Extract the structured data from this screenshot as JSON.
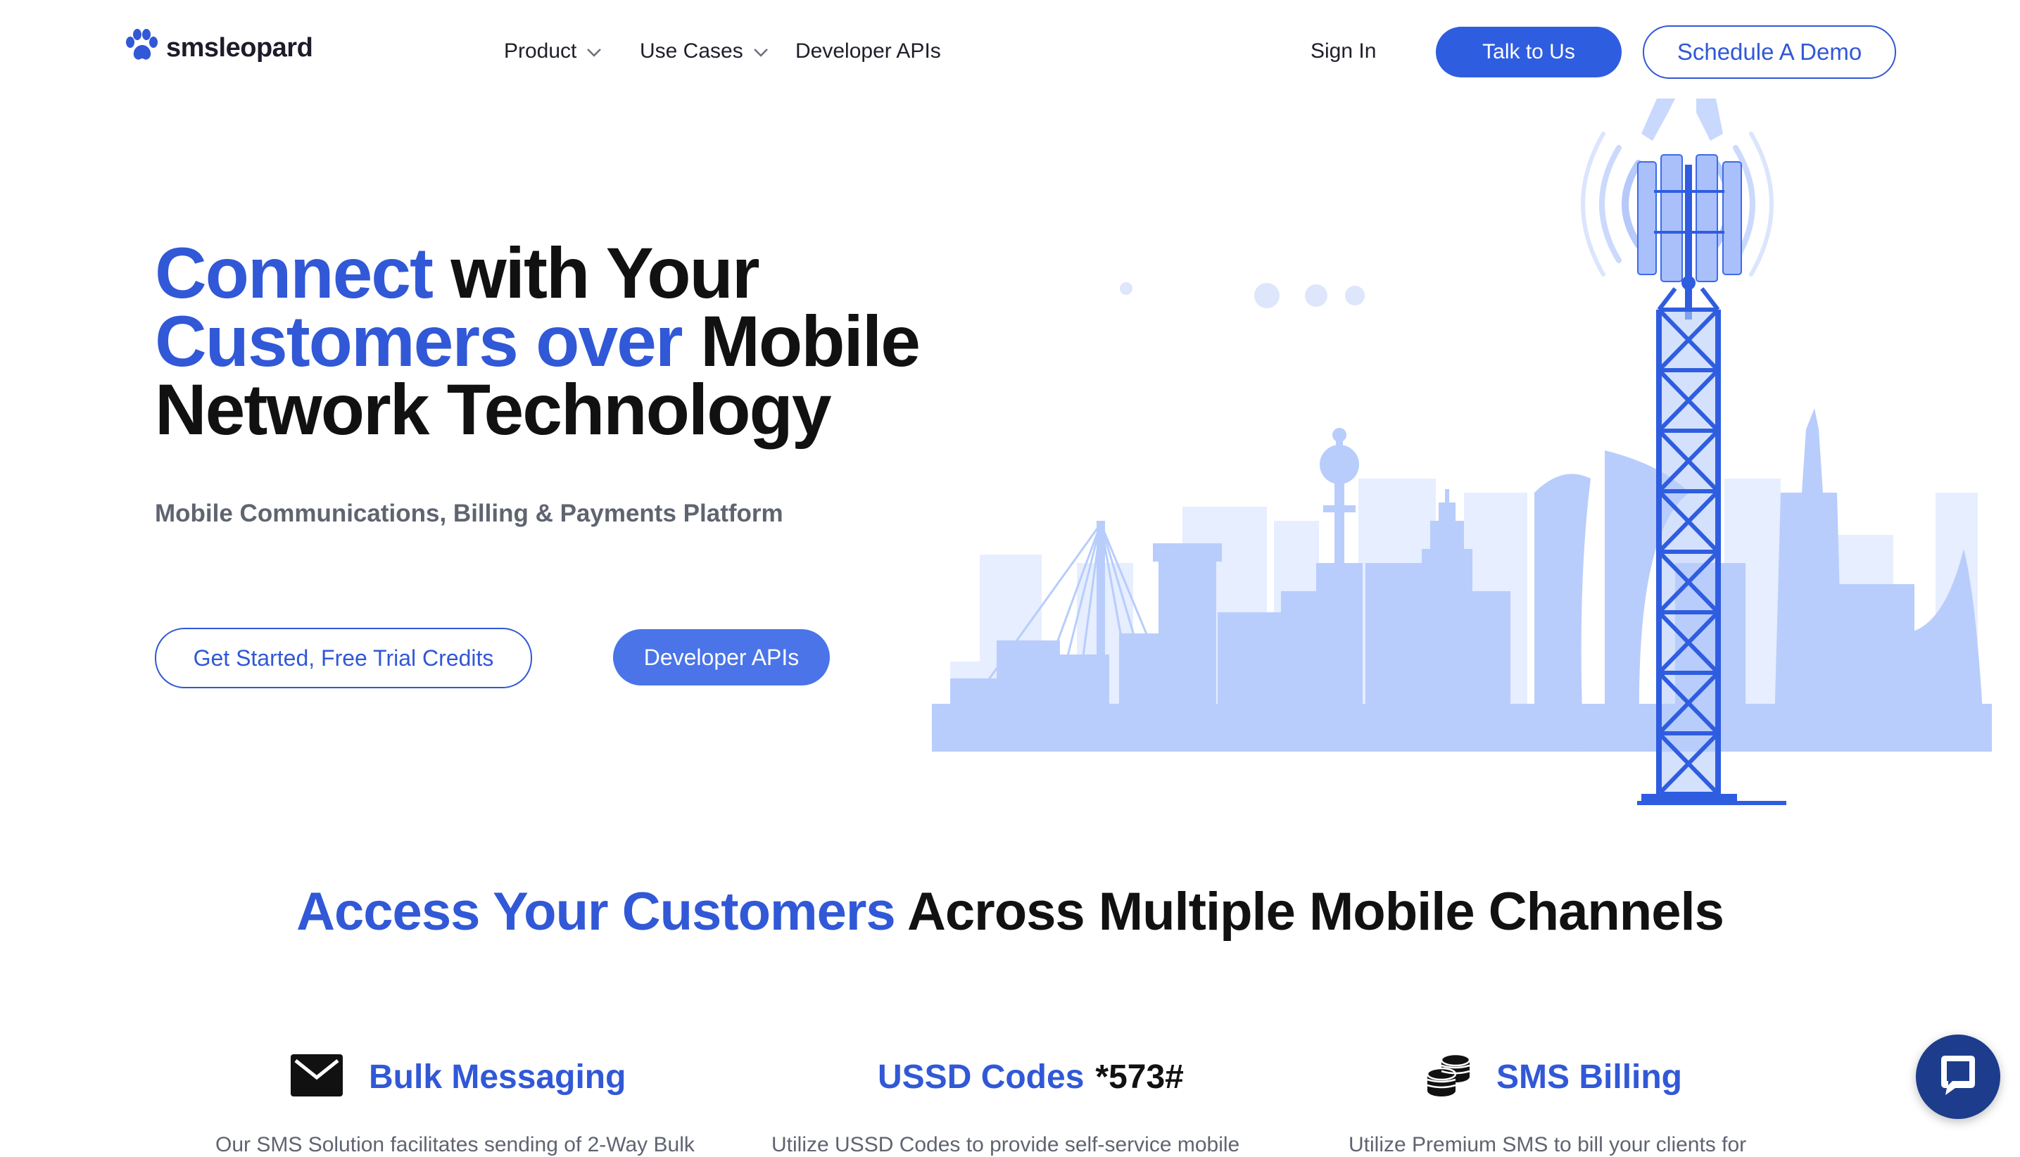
{
  "brand": {
    "name": "smsleopard",
    "logo_icon": "paw-icon",
    "accent": "#3158d6"
  },
  "nav": {
    "items": [
      {
        "label": "Product",
        "has_dropdown": true
      },
      {
        "label": "Use Cases",
        "has_dropdown": true
      },
      {
        "label": "Developer APIs",
        "has_dropdown": false
      }
    ],
    "sign_in": "Sign In",
    "talk": "Talk to Us",
    "demo": "Schedule A Demo"
  },
  "hero": {
    "title_blue_1": "Connect",
    "title_black_1": " with Your",
    "title_blue_2": "Customers over",
    "title_black_2": " Mobile",
    "title_black_3": "Network Technology",
    "subtitle": "Mobile Communications, Billing & Payments Platform",
    "cta_primary": "Get Started, Free Trial Credits",
    "cta_secondary": "Developer APIs",
    "illustration": "cell-tower-city-skyline"
  },
  "section": {
    "title_blue": "Access Your Customers",
    "title_black": " Across Multiple Mobile Channels"
  },
  "features": [
    {
      "icon": "envelope-icon",
      "label": "Bulk Messaging",
      "code": "",
      "desc": "Our SMS Solution facilitates sending of 2-Way Bulk"
    },
    {
      "icon": "",
      "label": "USSD Codes",
      "code": "*573#",
      "desc": "Utilize USSD Codes to provide self-service mobile"
    },
    {
      "icon": "coins-icon",
      "label": "SMS Billing",
      "code": "",
      "desc": "Utilize Premium SMS to bill your clients for"
    }
  ],
  "chat": {
    "icon": "chat-icon"
  }
}
